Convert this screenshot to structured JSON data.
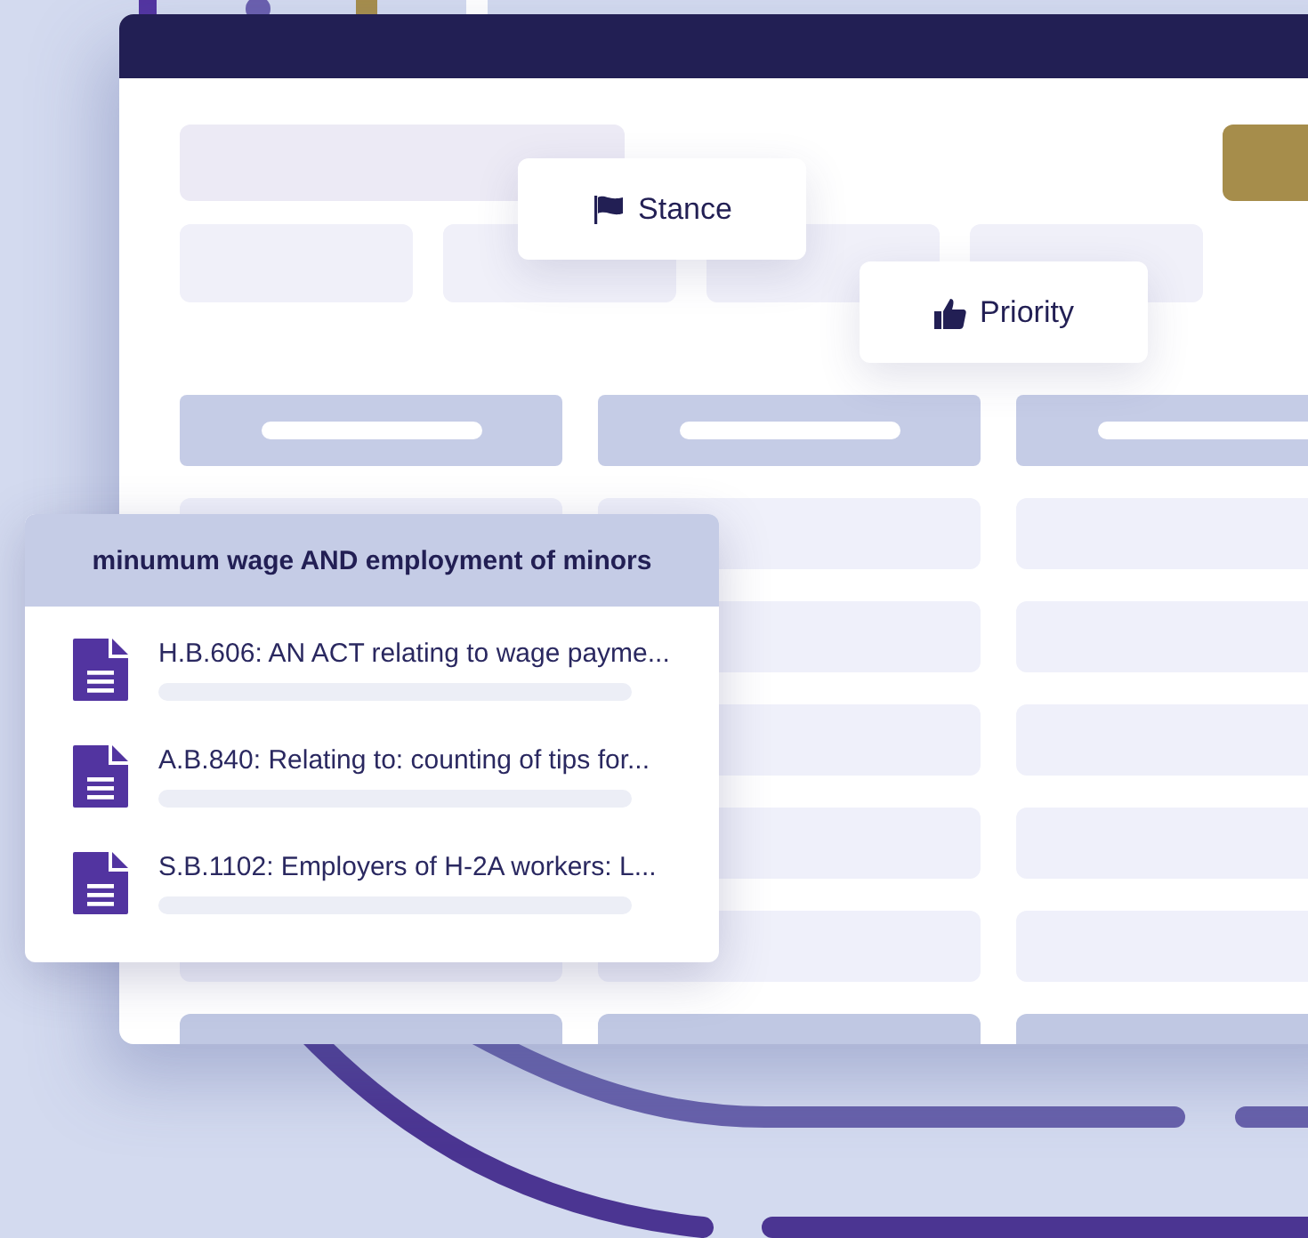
{
  "tags": [
    {
      "kind": "flag",
      "label": "Stance"
    },
    {
      "kind": "thumb",
      "label": "Priority"
    }
  ],
  "search": {
    "query": "minumum wage AND employment of minors",
    "results": [
      {
        "title": "H.B.606: AN ACT relating to wage payme..."
      },
      {
        "title": "A.B.840: Relating to: counting of tips for..."
      },
      {
        "title": "S.B.1102: Employers of H-2A workers: L..."
      }
    ]
  }
}
